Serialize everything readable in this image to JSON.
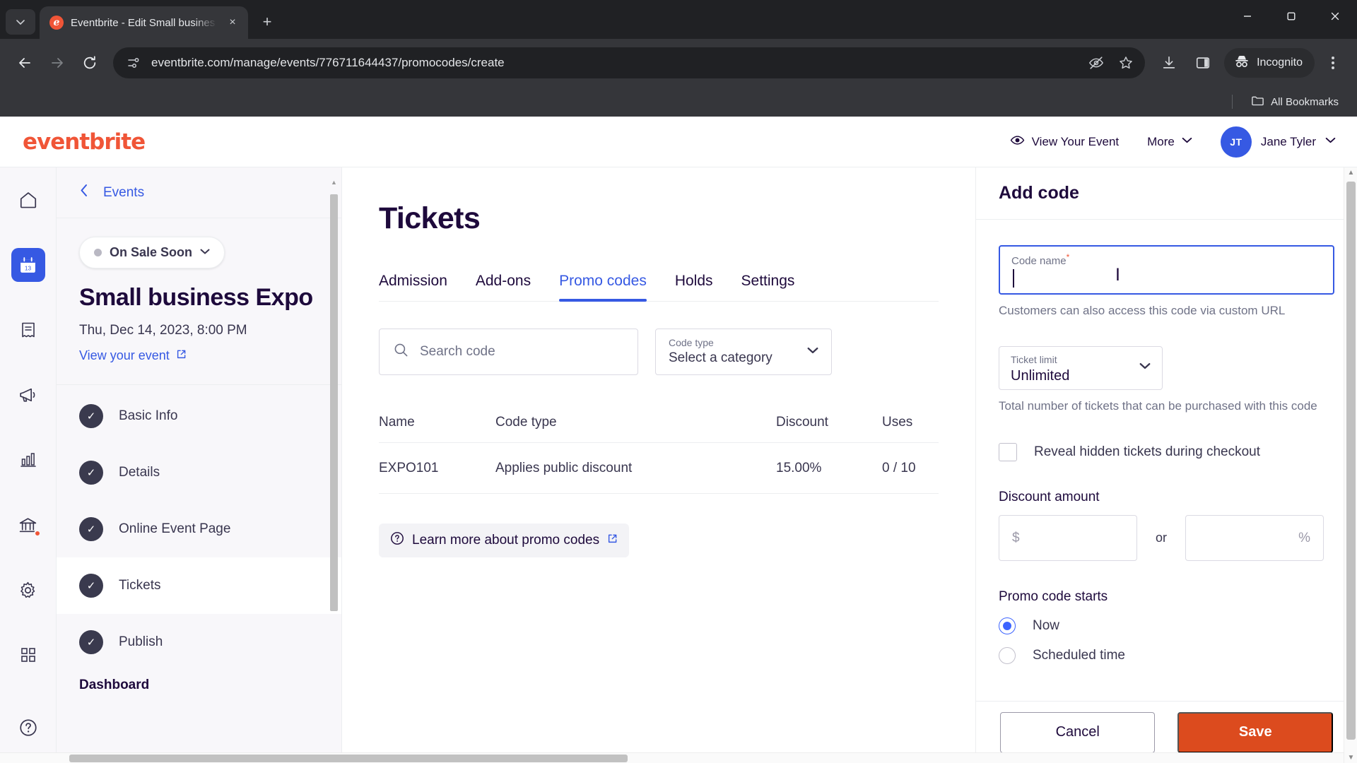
{
  "browser": {
    "tab": {
      "title": "Eventbrite - Edit Small busines",
      "favicon_letter": "e"
    },
    "tab_list_icon": "chevron-down-icon",
    "new_tab_label": "+",
    "close_label": "×",
    "url": "eventbrite.com/manage/events/776711644437/promocodes/create",
    "incognito_label": "Incognito",
    "bookmarks_label": "All Bookmarks",
    "icons": {
      "back": "back-arrow-icon",
      "forward": "forward-arrow-icon",
      "reload": "reload-icon",
      "site_info": "site-settings-icon",
      "tracking": "eye-off-icon",
      "bookmark": "star-icon",
      "downloads": "download-icon",
      "side_panel": "side-panel-icon",
      "incognito": "incognito-icon",
      "menu": "kebab-menu-icon",
      "minimize": "minimize-icon",
      "maximize": "maximize-icon",
      "close_window": "close-window-icon"
    }
  },
  "header": {
    "logo": "eventbrite",
    "view_event": "View Your Event",
    "more": "More",
    "user_initials": "JT",
    "user_name": "Jane Tyler"
  },
  "rail": {
    "items": [
      {
        "name": "home",
        "icon": "home-icon"
      },
      {
        "name": "events",
        "icon": "calendar-icon",
        "active": true
      },
      {
        "name": "orders",
        "icon": "receipt-icon"
      },
      {
        "name": "marketing",
        "icon": "megaphone-icon"
      },
      {
        "name": "reports",
        "icon": "bar-chart-icon"
      },
      {
        "name": "finance",
        "icon": "bank-icon",
        "badge": true
      },
      {
        "name": "settings",
        "icon": "gear-icon"
      },
      {
        "name": "apps",
        "icon": "grid-icon"
      },
      {
        "name": "help",
        "icon": "help-circle-icon"
      }
    ]
  },
  "event_nav": {
    "back_label": "Events",
    "status": "On Sale Soon",
    "title": "Small business Expo",
    "date": "Thu, Dec 14, 2023, 8:00 PM",
    "view_event_link": "View your event",
    "steps": [
      {
        "label": "Basic Info",
        "done": true
      },
      {
        "label": "Details",
        "done": true
      },
      {
        "label": "Online Event Page",
        "done": true
      },
      {
        "label": "Tickets",
        "done": true,
        "active": true
      },
      {
        "label": "Publish",
        "done": true
      }
    ],
    "next_section": "Dashboard"
  },
  "main": {
    "page_title": "Tickets",
    "tabs": [
      {
        "label": "Admission",
        "selected": false
      },
      {
        "label": "Add-ons",
        "selected": false
      },
      {
        "label": "Promo codes",
        "selected": true
      },
      {
        "label": "Holds",
        "selected": false
      },
      {
        "label": "Settings",
        "selected": false
      }
    ],
    "search_placeholder": "Search code",
    "code_type_filter": {
      "label": "Code type",
      "value": "Select a category"
    },
    "table": {
      "columns": [
        "Name",
        "Code type",
        "Discount",
        "Uses"
      ],
      "rows": [
        {
          "name": "EXPO101",
          "code_type": "Applies public discount",
          "discount": "15.00%",
          "uses": "0 / 10"
        }
      ]
    },
    "learn_more": "Learn more about promo codes"
  },
  "panel": {
    "title": "Add code",
    "code_name": {
      "label": "Code name",
      "required_mark": "*",
      "value": ""
    },
    "code_name_helper": "Customers can also access this code via custom URL",
    "ticket_limit": {
      "label": "Ticket limit",
      "value": "Unlimited"
    },
    "ticket_limit_helper": "Total number of tickets that can be purchased with this code",
    "reveal_hidden": {
      "label": "Reveal hidden tickets during checkout",
      "checked": false
    },
    "discount_amount_title": "Discount amount",
    "discount_dollar_placeholder": "$",
    "discount_or": "or",
    "discount_percent_placeholder": "%",
    "promo_starts_title": "Promo code starts",
    "promo_starts_options": [
      {
        "label": "Now",
        "selected": true
      },
      {
        "label": "Scheduled time",
        "selected": false
      }
    ],
    "cancel_label": "Cancel",
    "save_label": "Save"
  },
  "colors": {
    "brand_orange": "#f05537",
    "accent_blue": "#3659e3",
    "save_orange": "#dc4b1e",
    "ink": "#1e0a3c"
  }
}
